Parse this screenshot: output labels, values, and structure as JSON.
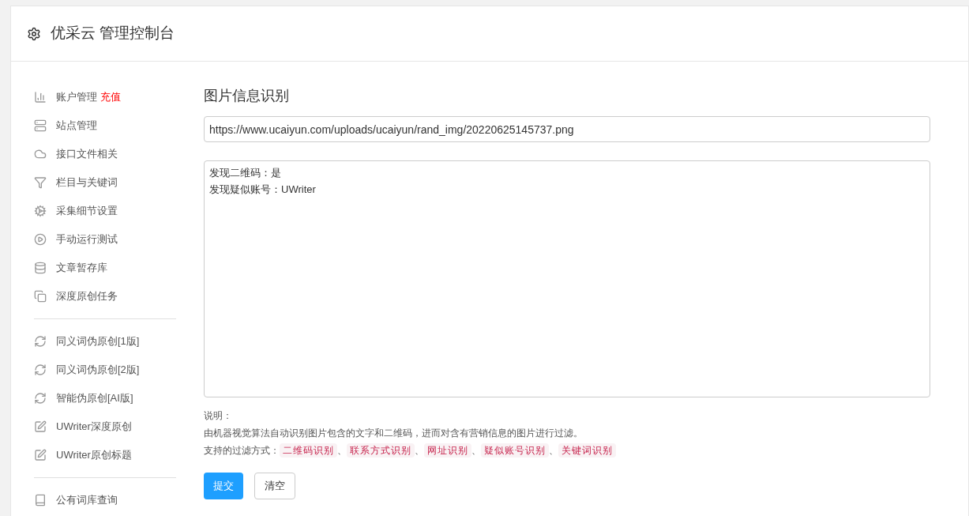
{
  "header": {
    "title": "优采云 管理控制台"
  },
  "sidebar": {
    "groups": [
      {
        "items": [
          {
            "label": "账户管理",
            "badge": "充值"
          },
          {
            "label": "站点管理"
          },
          {
            "label": "接口文件相关"
          },
          {
            "label": "栏目与关键词"
          },
          {
            "label": "采集细节设置"
          },
          {
            "label": "手动运行测试"
          },
          {
            "label": "文章暂存库"
          },
          {
            "label": "深度原创任务"
          }
        ]
      },
      {
        "items": [
          {
            "label": "同义词伪原创[1版]"
          },
          {
            "label": "同义词伪原创[2版]"
          },
          {
            "label": "智能伪原创[AI版]"
          },
          {
            "label": "UWriter深度原创"
          },
          {
            "label": "UWriter原创标题"
          }
        ]
      },
      {
        "items": [
          {
            "label": "公有词库查询"
          }
        ]
      }
    ]
  },
  "main": {
    "title": "图片信息识别",
    "url_field": {
      "value": "https://www.ucaiyun.com/uploads/ucaiyun/rand_img/20220625145737.png"
    },
    "result_box": {
      "lines": [
        "发现二维码：是",
        "发现疑似账号：UWriter"
      ]
    },
    "notes": {
      "heading": "说明：",
      "description": "由机器视觉算法自动识别图片包含的文字和二维码，进而对含有营销信息的图片进行过滤。",
      "methods_label": "支持的过滤方式：",
      "methods": [
        "二维码识别",
        "联系方式识别",
        "网址识别",
        "疑似账号识别",
        "关键词识别"
      ],
      "separator": "、"
    },
    "buttons": [
      {
        "kind": "primary",
        "label": "提交"
      },
      {
        "kind": "default",
        "label": "清空"
      }
    ]
  }
}
